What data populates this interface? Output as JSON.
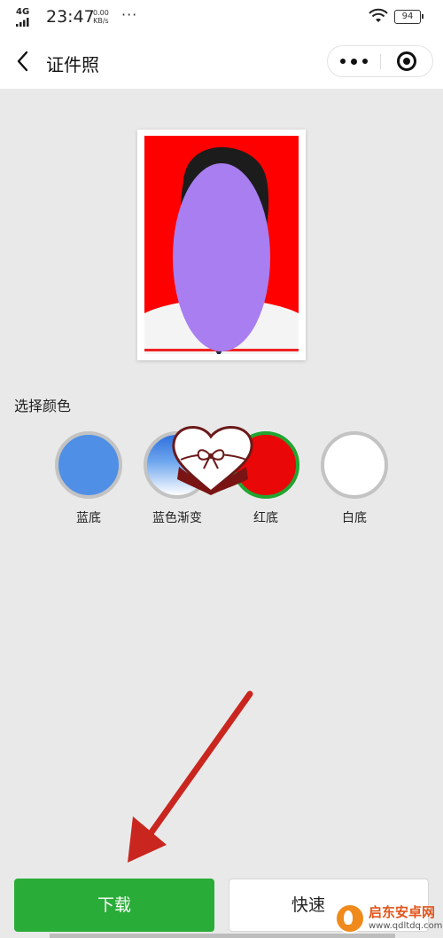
{
  "status_bar": {
    "network": "4G",
    "time": "23:47",
    "speed_value": "0.00",
    "speed_unit": "KB/s",
    "dots": "···",
    "battery": "94",
    "icons": [
      "signal-icon",
      "wifi-icon",
      "battery-icon"
    ]
  },
  "nav": {
    "title": "证件照",
    "icons": [
      "back-arrow-icon",
      "more-icon",
      "close-mini-program-icon"
    ]
  },
  "photo": {
    "background_color": "#ff0000"
  },
  "color_section": {
    "label": "选择颜色",
    "options": [
      {
        "label": "蓝底",
        "color": "#4f8fe6",
        "selected": false
      },
      {
        "label": "蓝色渐变",
        "color": "#2f6fdd",
        "selected": false
      },
      {
        "label": "红底",
        "color": "#e90707",
        "selected": true
      },
      {
        "label": "白底",
        "color": "#ffffff",
        "selected": false
      }
    ]
  },
  "actions": {
    "download_label": "下载",
    "quick_label": "快速"
  },
  "watermark": {
    "name": "启东安卓网",
    "url": "www.qdltdq.com"
  },
  "colors": {
    "accent_green": "#2aad38",
    "annotation_arrow": "#c9261f"
  }
}
